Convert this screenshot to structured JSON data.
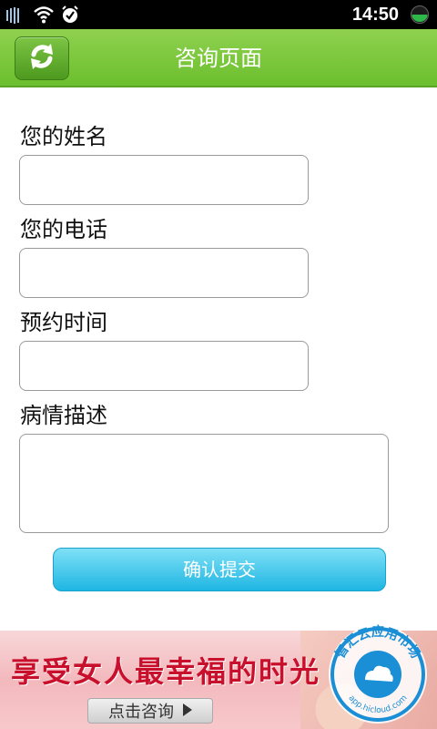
{
  "status_bar": {
    "time": "14:50",
    "icons": [
      "signal-icon",
      "wifi-icon",
      "alarm-icon",
      "battery-icon"
    ]
  },
  "title_bar": {
    "title": "咨询页面",
    "refresh_icon": "refresh-icon"
  },
  "form": {
    "name_label": "您的姓名",
    "phone_label": "您的电话",
    "time_label": "预约时间",
    "desc_label": "病情描述",
    "submit_label": "确认提交"
  },
  "banner": {
    "headline": "享受女人最幸福的时光",
    "button_label": "点击咨询"
  },
  "watermark": {
    "title": "智汇云应用市场",
    "url": "app.hicloud.com"
  },
  "colors": {
    "accent_green": "#6cbf2e",
    "submit_blue": "#1fb6e3",
    "banner_red": "#c80f2c"
  }
}
